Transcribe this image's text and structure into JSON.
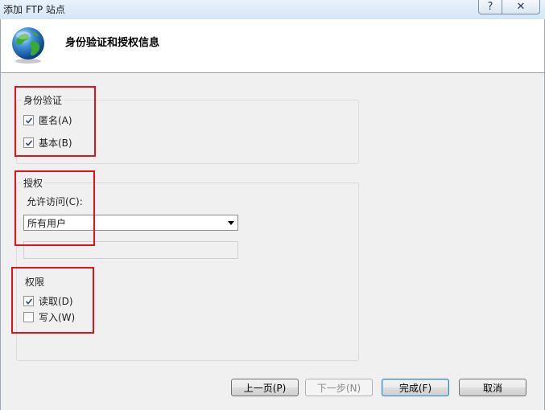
{
  "window": {
    "title": "添加 FTP 站点",
    "help_glyph": "?",
    "close_glyph": "✕"
  },
  "header": {
    "title": "身份验证和授权信息",
    "icon": "globe-icon"
  },
  "authentication": {
    "label": "身份验证",
    "anonymous": {
      "label": "匿名(A)",
      "checked": true
    },
    "basic": {
      "label": "基本(B)",
      "checked": true
    }
  },
  "authorization": {
    "label": "授权",
    "allow_access_label": "允许访问(C):",
    "allow_access_value": "所有用户",
    "users_textbox_value": ""
  },
  "permissions": {
    "label": "权限",
    "read": {
      "label": "读取(D)",
      "checked": true
    },
    "write": {
      "label": "写入(W)",
      "checked": false
    }
  },
  "buttons": {
    "previous": "上一页(P)",
    "next": "下一步(N)",
    "finish": "完成(F)",
    "cancel": "取消"
  },
  "colors": {
    "highlight_box": "#e0141c",
    "window_frame": "#dfeefa",
    "dialog_background": "#f0f0f0"
  }
}
